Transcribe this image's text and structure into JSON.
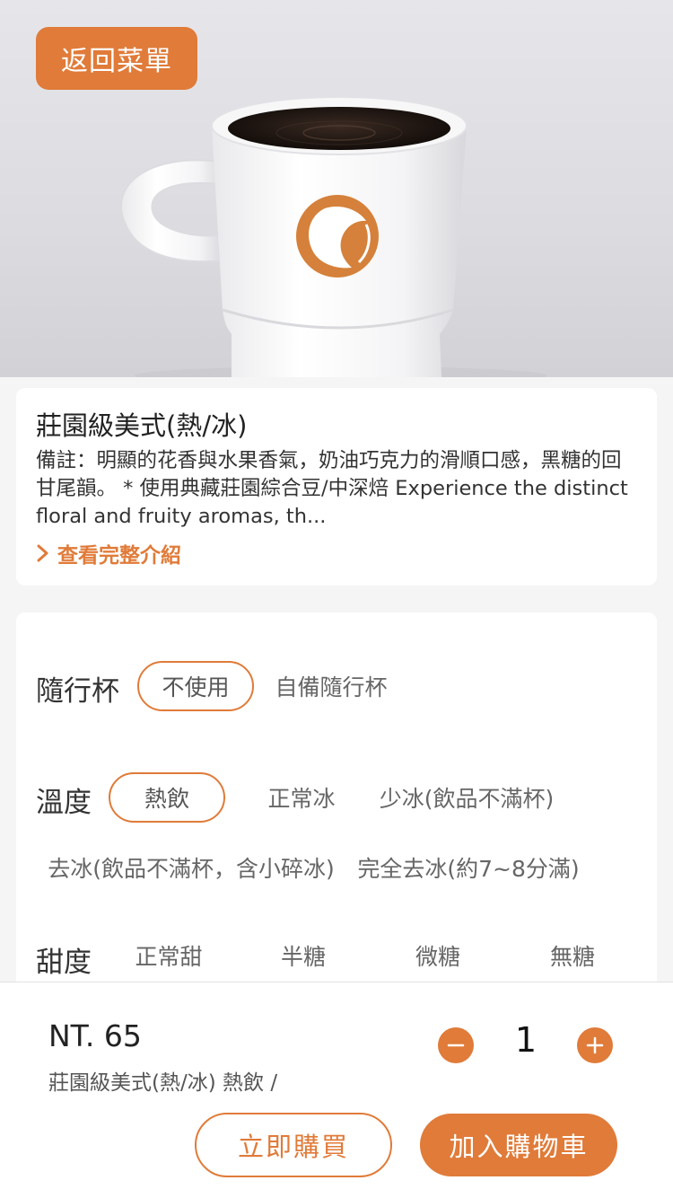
{
  "header": {
    "back_label": "返回菜單"
  },
  "product": {
    "title": "莊園級美式(熱/冰)",
    "description": "備註：明顯的花香與水果香氣，奶油巧克力的滑順口感，黑糖的回甘尾韻。 * 使用典藏莊園綜合豆/中深焙 Experience the distinct floral and fruity aromas, th...",
    "more_label": "查看完整介紹"
  },
  "options": {
    "cup": {
      "label": "隨行杯",
      "choices": [
        "不使用",
        "自備隨行杯"
      ],
      "selected": "不使用"
    },
    "temperature": {
      "label": "溫度",
      "choices": [
        "熱飲",
        "正常冰",
        "少冰(飲品不滿杯)",
        "去冰(飲品不滿杯，含小碎冰)",
        "完全去冰(約7~8分滿)"
      ],
      "selected": "熱飲"
    },
    "sweetness": {
      "label": "甜度",
      "choices": [
        "正常甜",
        "半糖",
        "微糖",
        "無糖"
      ]
    }
  },
  "footer": {
    "price": "NT. 65",
    "summary": "莊園級美式(熱/冰) 熱飲 /",
    "quantity": "1",
    "buy_now_label": "立即購買",
    "add_to_cart_label": "加入購物車"
  },
  "colors": {
    "accent": "#e07b39",
    "card": "#ffffff",
    "background": "#f5f5f5"
  },
  "icons": {
    "more": "chevron-right-icon",
    "decrease": "minus-icon",
    "increase": "plus-icon",
    "logo": "brand-logo"
  }
}
